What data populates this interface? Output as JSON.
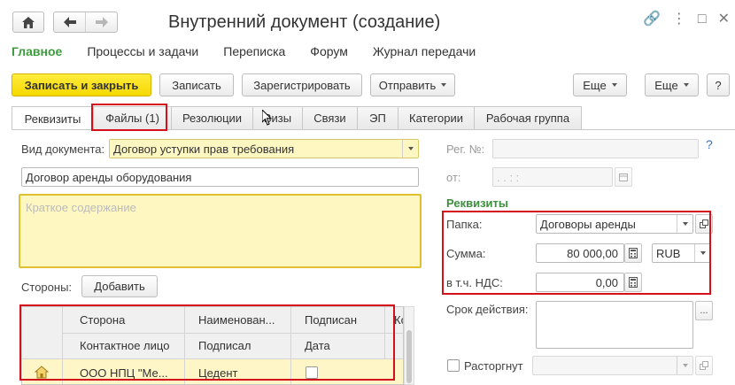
{
  "nav": {
    "home_icon": "home-icon",
    "back_icon": "arrow-left-icon",
    "forward_icon": "arrow-right-icon"
  },
  "window": {
    "title": "Внутренний документ (создание)"
  },
  "sections": [
    {
      "label": "Главное"
    },
    {
      "label": "Процессы и задачи"
    },
    {
      "label": "Переписка"
    },
    {
      "label": "Форум"
    },
    {
      "label": "Журнал передачи"
    }
  ],
  "toolbar": {
    "save_close": "Записать и закрыть",
    "save": "Записать",
    "register": "Зарегистрировать",
    "send": "Отправить",
    "more1": "Еще",
    "more2": "Еще",
    "help": "?"
  },
  "tabs": [
    {
      "label": "Реквизиты"
    },
    {
      "label": "Файлы (1)"
    },
    {
      "label": "Резолюции"
    },
    {
      "label": "Визы"
    },
    {
      "label": "Связи"
    },
    {
      "label": "ЭП"
    },
    {
      "label": "Категории"
    },
    {
      "label": "Рабочая группа"
    }
  ],
  "left": {
    "doc_type_label": "Вид документа:",
    "doc_type_value": "Договор уступки прав требования",
    "name_value": "Договор аренды оборудования",
    "summary_placeholder": "Краткое содержание",
    "parties_label": "Стороны:",
    "add_button": "Добавить"
  },
  "table": {
    "headers_row1": [
      "Сторона",
      "Наименован...",
      "Подписан",
      "Ко"
    ],
    "headers_row2": [
      "Контактное лицо",
      "Подписал",
      "Дата"
    ],
    "rows": [
      {
        "side": "ООО НПЦ \"Ме...",
        "name": "Цедент"
      }
    ]
  },
  "right": {
    "reg_no_label": "Рег. №:",
    "from_label": "от:",
    "date_placeholder": ". .  :  :",
    "help_mark": "?",
    "requisites_title": "Реквизиты",
    "folder_label": "Папка:",
    "folder_value": "Договоры аренды",
    "sum_label": "Сумма:",
    "sum_value": "80 000,00",
    "currency_value": "RUB",
    "vat_label": "в т.ч. НДС:",
    "vat_value": "0,00",
    "validity_label": "Срок действия:",
    "terminated_label": "Расторгнут"
  }
}
